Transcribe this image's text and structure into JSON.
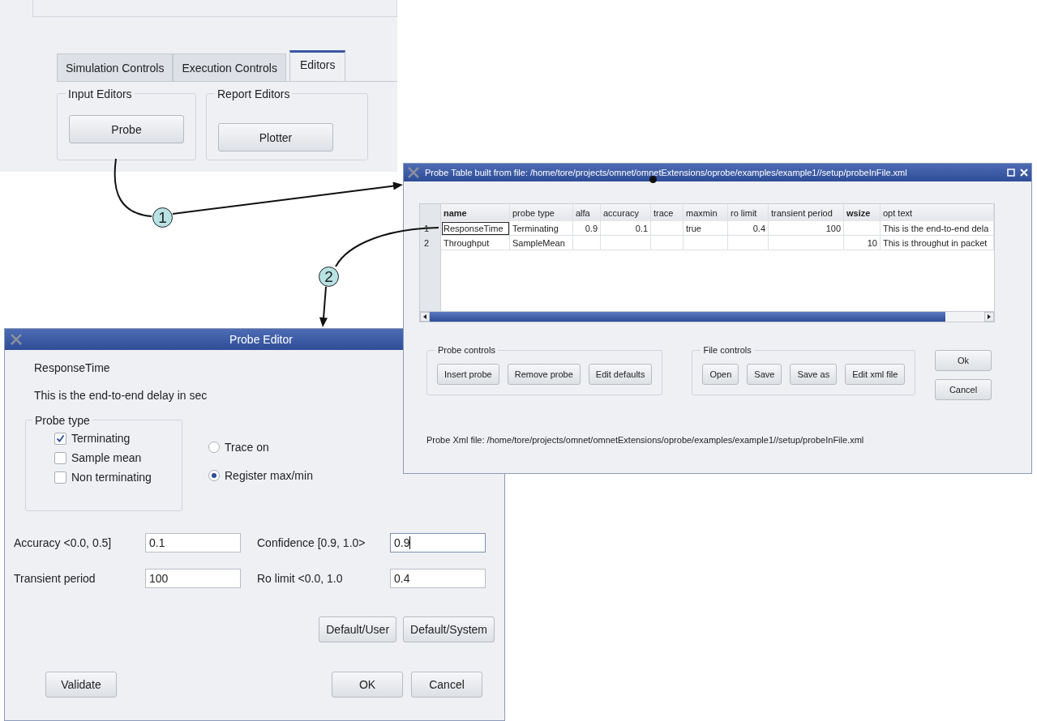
{
  "control_panel": {
    "tabs": [
      {
        "label": "Simulation Controls",
        "selected": false
      },
      {
        "label": "Execution Controls",
        "selected": false
      },
      {
        "label": "Editors",
        "selected": true
      }
    ],
    "groups": [
      {
        "title": "Input Editors",
        "button": "Probe"
      },
      {
        "title": "Report Editors",
        "button": "Plotter"
      }
    ]
  },
  "step_markers": [
    "1",
    "2"
  ],
  "probe_table_window": {
    "title": "Probe Table built from file: /home/tore/projects/omnet/omnetExtensions/oprobe/examples/example1//setup/probeInFile.xml",
    "table": {
      "columns": [
        {
          "label": "name",
          "bold": true,
          "kind": "text"
        },
        {
          "label": "probe type",
          "bold": false,
          "kind": "text"
        },
        {
          "label": "alfa",
          "bold": false,
          "kind": "number"
        },
        {
          "label": "accuracy",
          "bold": false,
          "kind": "number"
        },
        {
          "label": "trace",
          "bold": false,
          "kind": "text"
        },
        {
          "label": "maxmin",
          "bold": false,
          "kind": "text"
        },
        {
          "label": "ro limit",
          "bold": false,
          "kind": "number"
        },
        {
          "label": "transient period",
          "bold": false,
          "kind": "number"
        },
        {
          "label": "wsize",
          "bold": true,
          "kind": "number"
        },
        {
          "label": "opt text",
          "bold": false,
          "kind": "text"
        }
      ],
      "rows": [
        {
          "number": "1",
          "selected": true,
          "cells": [
            "ResponseTime",
            "Terminating",
            "0.9",
            "0.1",
            "",
            "true",
            "0.4",
            "100",
            "",
            "This is the end-to-end dela"
          ]
        },
        {
          "number": "2",
          "selected": false,
          "cells": [
            "Throughput",
            "SampleMean",
            "",
            "",
            "",
            "",
            "",
            "",
            "10",
            "This is throughut in packet"
          ]
        }
      ]
    },
    "groups": [
      {
        "title": "Probe controls",
        "buttons": [
          "Insert probe",
          "Remove probe",
          "Edit defaults"
        ]
      },
      {
        "title": "File controls",
        "buttons": [
          "Open",
          "Save",
          "Save as",
          "Edit xml file"
        ]
      }
    ],
    "side_buttons": [
      "Ok",
      "Cancel"
    ],
    "file_label": "Probe Xml file: /home/tore/projects/omnet/omnetExtensions/oprobe/examples/example1//setup/probeInFile.xml"
  },
  "probe_editor": {
    "title": "Probe Editor",
    "probe_name": "ResponseTime",
    "description": "This is the end-to-end delay in sec",
    "probe_type": {
      "title": "Probe type",
      "options": [
        {
          "label": "Terminating",
          "checked": true
        },
        {
          "label": "Sample mean",
          "checked": false
        },
        {
          "label": "Non terminating",
          "checked": false
        }
      ]
    },
    "radios": [
      {
        "label": "Trace on",
        "selected": false
      },
      {
        "label": "Register max/min",
        "selected": true
      }
    ],
    "fields": [
      {
        "label": "Accuracy <0.0, 0.5]",
        "value": "0.1",
        "focused": false
      },
      {
        "label": "Confidence [0.9, 1.0>",
        "value": "0.9",
        "focused": true
      },
      {
        "label": "Transient period",
        "value": "100",
        "focused": false
      },
      {
        "label": "Ro limit <0.0, 1.0",
        "value": "0.4",
        "focused": false
      }
    ],
    "default_buttons": [
      "Default/User",
      "Default/System"
    ],
    "validate_button": "Validate",
    "dialog_buttons": [
      "OK",
      "Cancel"
    ]
  }
}
